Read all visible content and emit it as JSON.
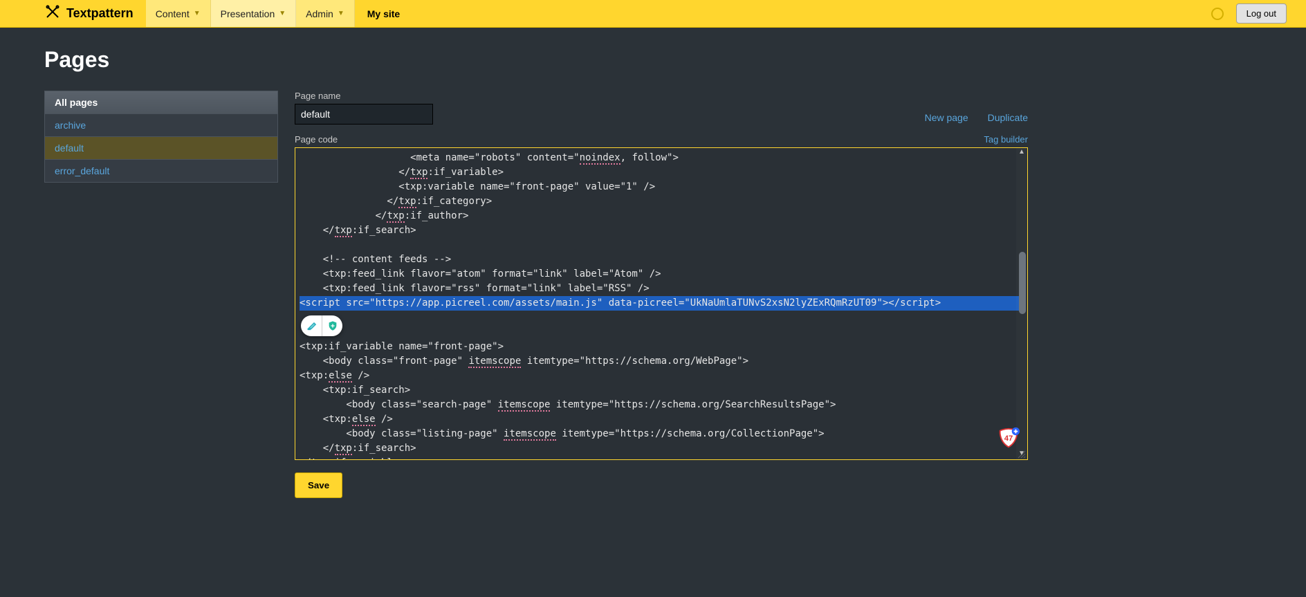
{
  "app_name": "Textpattern",
  "topnav": {
    "content": "Content",
    "presentation": "Presentation",
    "admin": "Admin",
    "site_link": "My site",
    "logout": "Log out"
  },
  "page_heading": "Pages",
  "sidebar": {
    "heading": "All pages",
    "items": [
      {
        "label": "archive",
        "selected": false
      },
      {
        "label": "default",
        "selected": true
      },
      {
        "label": "error_default",
        "selected": false
      }
    ]
  },
  "form": {
    "name_label": "Page name",
    "name_value": "default",
    "new_page": "New page",
    "duplicate": "Duplicate",
    "code_label": "Page code",
    "tag_builder": "Tag builder",
    "save": "Save"
  },
  "code": {
    "lines": [
      {
        "indent": 19,
        "pre": "<meta name=\"robots\" content=\"",
        "u": "noindex",
        "post": ", follow\">"
      },
      {
        "indent": 17,
        "pre": "</",
        "u": "txp",
        "post": ":if_variable>"
      },
      {
        "indent": 17,
        "pre": "<txp:variable name=\"front-page\" value=\"1\" />",
        "u": "",
        "post": ""
      },
      {
        "indent": 15,
        "pre": "</",
        "u": "txp",
        "post": ":if_category>"
      },
      {
        "indent": 13,
        "pre": "</",
        "u": "txp",
        "post": ":if_author>"
      },
      {
        "indent": 4,
        "pre": "</",
        "u": "txp",
        "post": ":if_search>"
      },
      {
        "indent": 0,
        "blank": true
      },
      {
        "indent": 4,
        "pre": "<!-- content feeds -->",
        "u": "",
        "post": ""
      },
      {
        "indent": 4,
        "pre": "<txp:feed_link flavor=\"atom\" format=\"link\" label=\"Atom\" />",
        "u": "",
        "post": ""
      },
      {
        "indent": 4,
        "pre": "<txp:feed_link flavor=\"rss\" format=\"link\" label=\"RSS\" />",
        "u": "",
        "post": ""
      },
      {
        "indent": 0,
        "hl": true,
        "pre": "<script src=\"https://app.picreel.com/assets/main.js\" data-picreel=\"UkNaUmlaTUNvS2xsN2lyZExRQmRzUT09\"></script>",
        "u": "",
        "post": ""
      },
      {
        "indent": 0,
        "blank": true
      },
      {
        "indent": 0,
        "blank": true
      },
      {
        "indent": 0,
        "pre": "<txp:if_variable name=\"front-page\">",
        "u": "",
        "post": ""
      },
      {
        "indent": 4,
        "pre": "<body class=\"front-page\" ",
        "u": "itemscope",
        "post": " itemtype=\"https://schema.org/WebPage\">"
      },
      {
        "indent": 0,
        "pre": "<txp:",
        "u": "else",
        "post": " />"
      },
      {
        "indent": 4,
        "pre": "<txp:if_search>",
        "u": "",
        "post": ""
      },
      {
        "indent": 8,
        "pre": "<body class=\"search-page\" ",
        "u": "itemscope",
        "post": " itemtype=\"https://schema.org/SearchResultsPage\">"
      },
      {
        "indent": 4,
        "pre": "<txp:",
        "u": "else",
        "post": " />"
      },
      {
        "indent": 8,
        "pre": "<body class=\"listing-page\" ",
        "u": "itemscope",
        "post": " itemtype=\"https://schema.org/CollectionPage\">"
      },
      {
        "indent": 4,
        "pre": "</",
        "u": "txp",
        "post": ":if_search>"
      },
      {
        "indent": 0,
        "pre": "</",
        "u": "txp",
        "post": ":if_variable>"
      }
    ]
  },
  "badge_number": "47"
}
